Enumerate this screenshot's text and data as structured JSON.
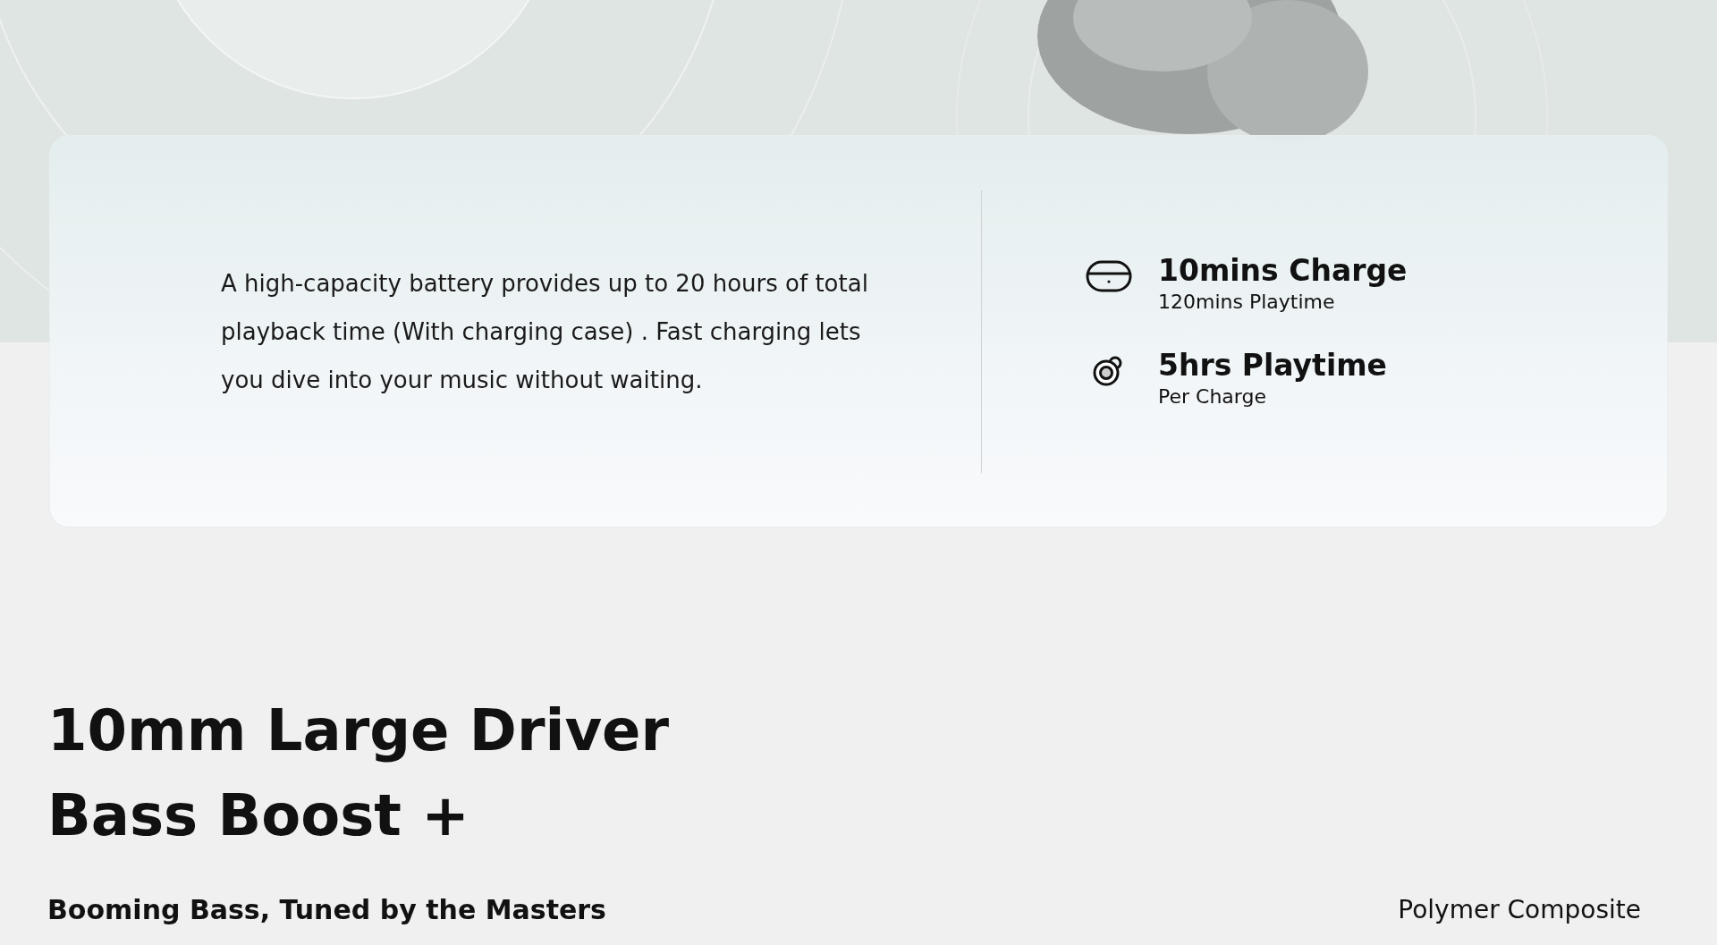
{
  "battery_card": {
    "description": "A high-capacity battery provides up to 20 hours of total playback time (With charging case) . Fast charging lets you dive into your music without waiting.",
    "stats": [
      {
        "kind": "case",
        "title": "10mins Charge",
        "subtitle": "120mins Playtime"
      },
      {
        "kind": "earbud",
        "title": "5hrs Playtime",
        "subtitle": "Per Charge"
      }
    ]
  },
  "driver_section": {
    "heading_lines": [
      "10mm Large Driver",
      "Bass Boost +"
    ],
    "subheading": "Booming Bass, Tuned by the Masters",
    "material_label": "Polymer Composite"
  }
}
